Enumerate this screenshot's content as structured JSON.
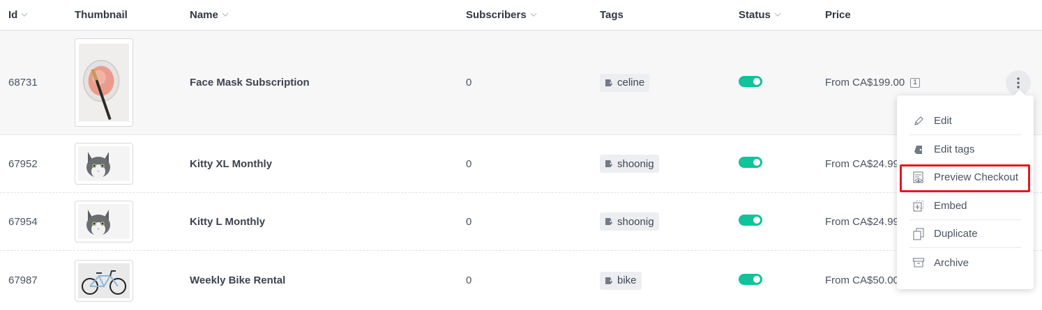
{
  "header": {
    "id": "Id",
    "thumbnail": "Thumbnail",
    "name": "Name",
    "subscribers": "Subscribers",
    "tags": "Tags",
    "status": "Status",
    "price": "Price"
  },
  "rows": [
    {
      "id": "68731",
      "name": "Face Mask Subscription",
      "subscribers": "0",
      "tag": "celine",
      "status": "on",
      "price": "From CA$199.00",
      "price_count": "1",
      "thumbnail": "face-mask-photo"
    },
    {
      "id": "67952",
      "name": "Kitty XL Monthly",
      "subscribers": "0",
      "tag": "shoonig",
      "status": "on",
      "price": "From CA$24.99",
      "thumbnail": "kitten-photo"
    },
    {
      "id": "67954",
      "name": "Kitty L Monthly",
      "subscribers": "0",
      "tag": "shoonig",
      "status": "on",
      "price": "From CA$24.99",
      "thumbnail": "kitten-photo"
    },
    {
      "id": "67987",
      "name": "Weekly Bike Rental",
      "subscribers": "0",
      "tag": "bike",
      "status": "on",
      "price": "From CA$50.00",
      "thumbnail": "bicycle-photo"
    }
  ],
  "menu": {
    "items": [
      {
        "label": "Edit",
        "icon": "pencil-icon"
      },
      {
        "label": "Edit tags",
        "icon": "tag-icon"
      },
      {
        "label": "Preview Checkout",
        "icon": "preview-eye-icon"
      },
      {
        "label": "Embed",
        "icon": "embed-icon"
      },
      {
        "label": "Duplicate",
        "icon": "duplicate-icon"
      },
      {
        "label": "Archive",
        "icon": "archive-icon"
      }
    ],
    "highlighted": "Preview Checkout"
  },
  "colors": {
    "toggle_on": "#0fc39a",
    "highlight_box": "#e8141c"
  }
}
